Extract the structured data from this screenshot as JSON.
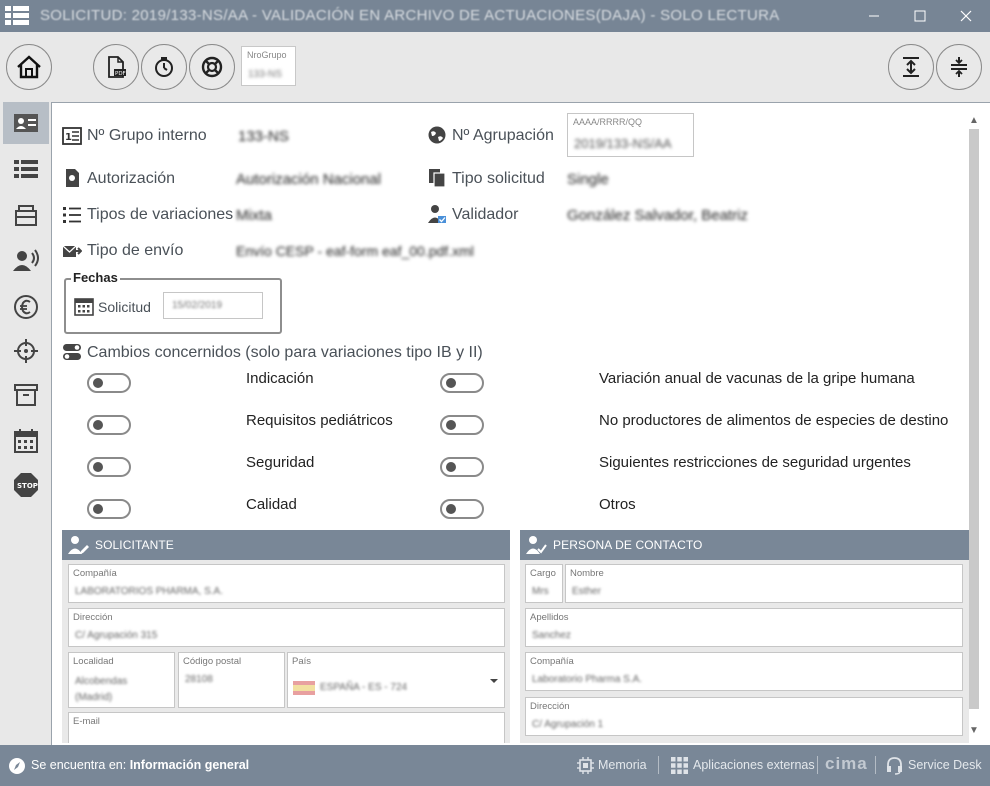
{
  "window": {
    "title": "SOLICITUD: 2019/133-NS/AA - VALIDACIÓN EN ARCHIVO DE ACTUACIONES(DAJA) - SOLO LECTURA"
  },
  "toolbar": {
    "nrogrupo_label": "NroGrupo",
    "nrogrupo_value": "133-NS"
  },
  "fields": {
    "grupo_interno_label": "Nº Grupo interno",
    "grupo_interno_value": "133-NS",
    "agrupacion_label": "Nº Agrupación",
    "agrupacion_placeholder": "AAAA/RRRR/QQ",
    "agrupacion_value": "2019/133-NS/AA",
    "autorizacion_label": "Autorización",
    "autorizacion_value": "Autorización Nacional",
    "tipo_solicitud_label": "Tipo solicitud",
    "tipo_solicitud_value": "Single",
    "tipos_variaciones_label": "Tipos de variaciones",
    "tipos_variaciones_value": "Mixta",
    "validador_label": "Validador",
    "validador_value": "González Salvador, Beatriz",
    "tipo_envio_label": "Tipo de envío",
    "tipo_envio_value": "Envío CESP - eaf-form eaf_00.pdf.xml"
  },
  "fechas": {
    "legend": "Fechas",
    "solicitud_label": "Solicitud",
    "solicitud_value": "15/02/2019"
  },
  "cambios": {
    "title": "Cambios concernidos (solo para variaciones tipo IB y II)",
    "left": [
      "Indicación",
      "Requisitos pediátricos",
      "Seguridad",
      "Calidad"
    ],
    "right": [
      "Variación anual de vacunas de la gripe humana",
      "No productores de alimentos de especies de destino",
      "Siguientes restricciones de seguridad urgentes",
      "Otros"
    ]
  },
  "solicitante": {
    "title": "SOLICITANTE",
    "compania_label": "Compañía",
    "compania_value": "LABORATORIOS PHARMA, S.A.",
    "direccion_label": "Dirección",
    "direccion_value": "C/ Agrupación 315",
    "localidad_label": "Localidad",
    "localidad_value": "Alcobendas (Madrid)",
    "cp_label": "Código postal",
    "cp_value": "28108",
    "pais_label": "País",
    "pais_value": "ESPAÑA - ES - 724",
    "email_label": "E-mail",
    "email_value": ""
  },
  "contacto": {
    "title": "PERSONA DE CONTACTO",
    "cargo_label": "Cargo",
    "cargo_value": "Mrs",
    "nombre_label": "Nombre",
    "nombre_value": "Esther",
    "apellidos_label": "Apellidos",
    "apellidos_value": "Sanchez",
    "compania_label": "Compañía",
    "compania_value": "Laboratorio Pharma S.A.",
    "direccion_label": "Dirección",
    "direccion_value": "C/ Agrupación 1"
  },
  "statusbar": {
    "location_prefix": "Se encuentra en: ",
    "location_value": "Información general",
    "memoria": "Memoria",
    "aplicaciones": "Aplicaciones externas",
    "brand": "cima",
    "service_desk": "Service Desk"
  },
  "colors": {
    "titlebar": "#778595",
    "panel_header": "#798797",
    "statusbar": "#798797",
    "sidebar_active": "#b7bec6"
  }
}
